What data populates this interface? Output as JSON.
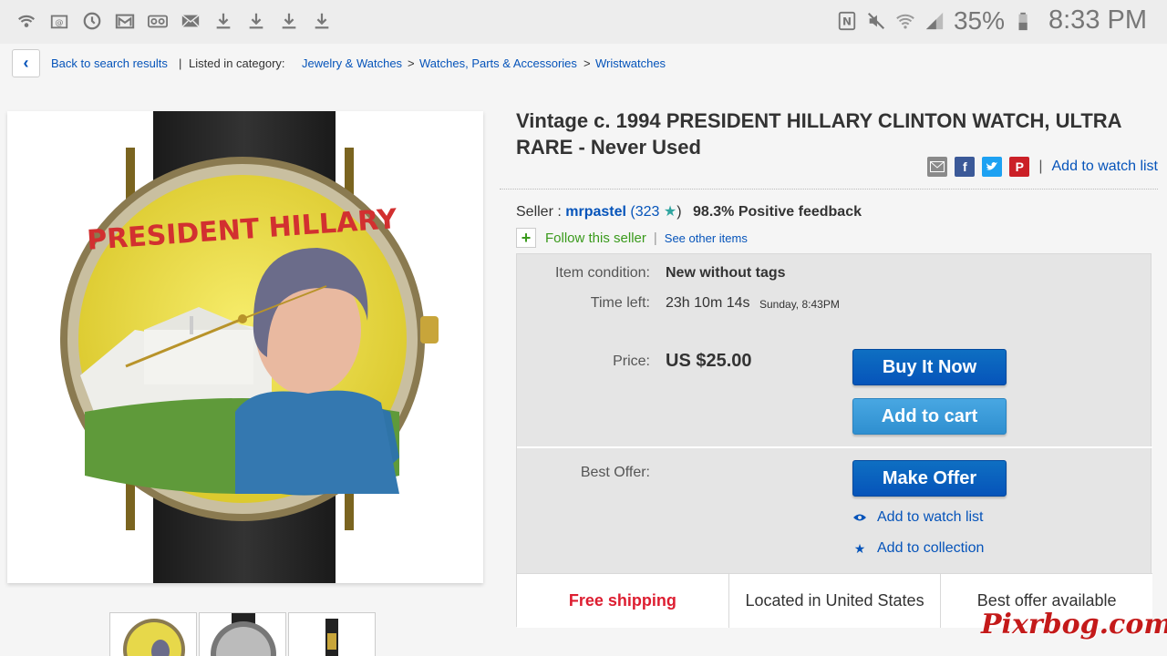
{
  "status_bar": {
    "left_icons": [
      "wifi-call-icon",
      "email-app-icon",
      "sync-icon",
      "gmail-icon",
      "voicemail-icon",
      "envelope-icon",
      "download-icon",
      "download-icon",
      "download-icon",
      "download-icon"
    ],
    "right_icons": [
      "nfc-icon",
      "mute-icon",
      "wifi-icon",
      "signal-icon",
      "battery-icon"
    ],
    "battery": "35%",
    "time": "8:33 PM"
  },
  "breadcrumb": {
    "back_label": "Back to search results",
    "separator": "|",
    "listed_in": "Listed in category:",
    "categories": [
      "Jewelry & Watches",
      "Watches, Parts & Accessories",
      "Wristwatches"
    ],
    "arrow": ">"
  },
  "listing": {
    "title": "Vintage c. 1994 PRESIDENT HILLARY CLINTON WATCH, ULTRA RARE - Never Used",
    "watch_face_text": "PRESIDENT HILLARY",
    "share_icons": [
      "email-share-icon",
      "facebook-icon",
      "twitter-icon",
      "pinterest-icon"
    ],
    "add_watch_list": "Add to watch list"
  },
  "seller": {
    "label": "Seller :",
    "name": "mrpastel",
    "score": "323",
    "feedback": "98.3% Positive feedback",
    "follow": "Follow this seller",
    "see_other": "See other items"
  },
  "details": {
    "condition_label": "Item condition:",
    "condition_value": "New without tags",
    "time_label": "Time left:",
    "time_value": "23h 10m 14s",
    "time_end": "Sunday, 8:43PM",
    "price_label": "Price:",
    "price_value": "US $25.00",
    "buy_now": "Buy It Now",
    "add_cart": "Add to cart",
    "best_offer_label": "Best Offer:",
    "make_offer": "Make Offer",
    "add_watch": "Add to watch list",
    "add_collection": "Add to collection"
  },
  "features": [
    "Free shipping",
    "Located in United States",
    "Best offer available"
  ],
  "watermark": "Pixrbog.com",
  "colors": {
    "link": "#0654ba",
    "follow_green": "#3a9a1c",
    "free_shipping_red": "#dd1e31",
    "button_dark": "#0654ba",
    "button_light": "#3c9bdc"
  }
}
